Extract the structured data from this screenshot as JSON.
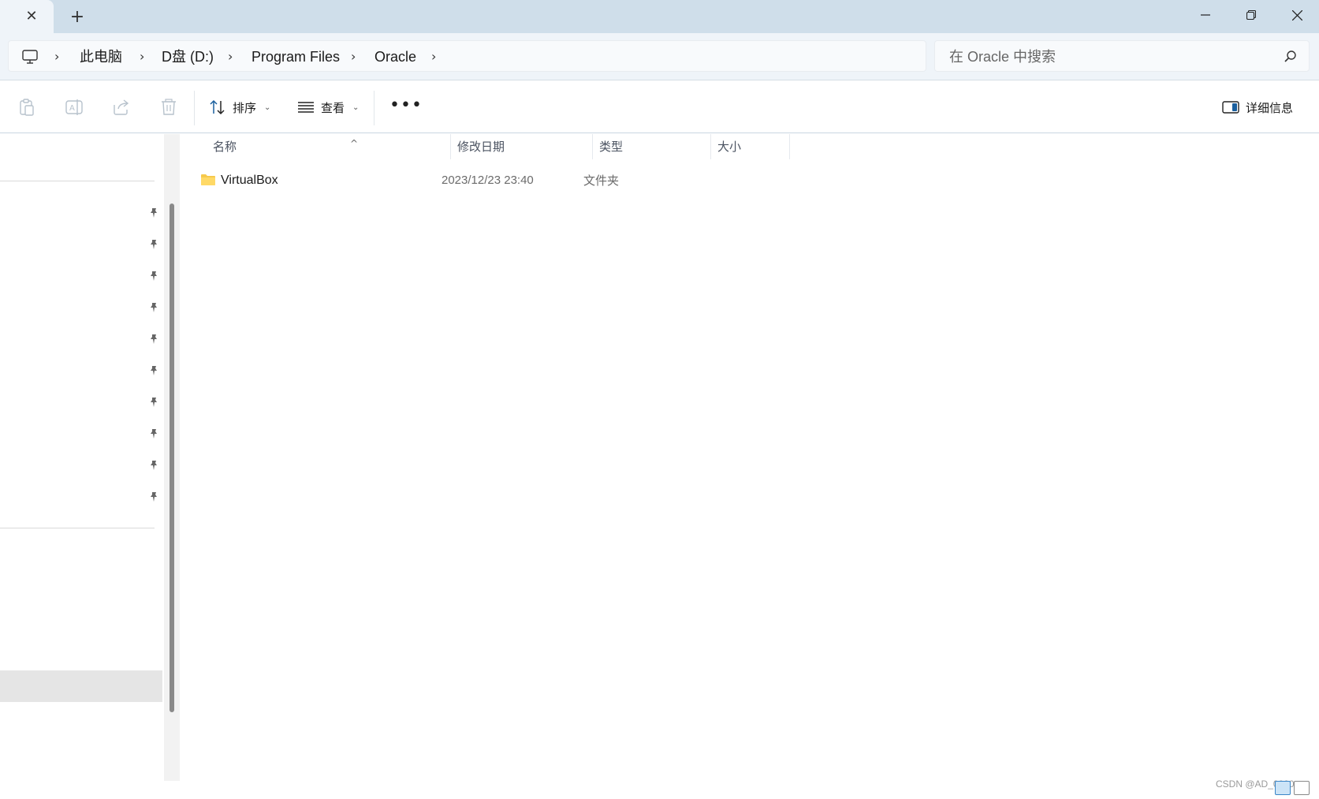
{
  "titlebar": {
    "tab_close_icon": "close-icon",
    "new_tab_icon": "plus-icon",
    "minimize_icon": "minimize-icon",
    "restore_icon": "restore-icon",
    "close_icon": "close-icon"
  },
  "address": {
    "root_icon": "computer-icon",
    "crumbs": [
      "此电脑",
      "D盘 (D:)",
      "Program Files",
      "Oracle"
    ],
    "chevron": "›"
  },
  "search": {
    "placeholder": "在 Oracle 中搜索",
    "icon": "search-icon"
  },
  "commandbar": {
    "sort_label": "排序",
    "view_label": "查看",
    "more_label": "•••",
    "details_label": "详细信息"
  },
  "columns": {
    "name": "名称",
    "modified": "修改日期",
    "type": "类型",
    "size": "大小"
  },
  "files": [
    {
      "name": "VirtualBox",
      "modified": "2023/12/23 23:40",
      "type": "文件夹",
      "size": ""
    }
  ],
  "watermark": "CSDN @AD_0000",
  "colors": {
    "titlebar_bg": "#cfdeea",
    "addrrow_bg": "#eff4f9",
    "folder": "#f6c94c"
  }
}
